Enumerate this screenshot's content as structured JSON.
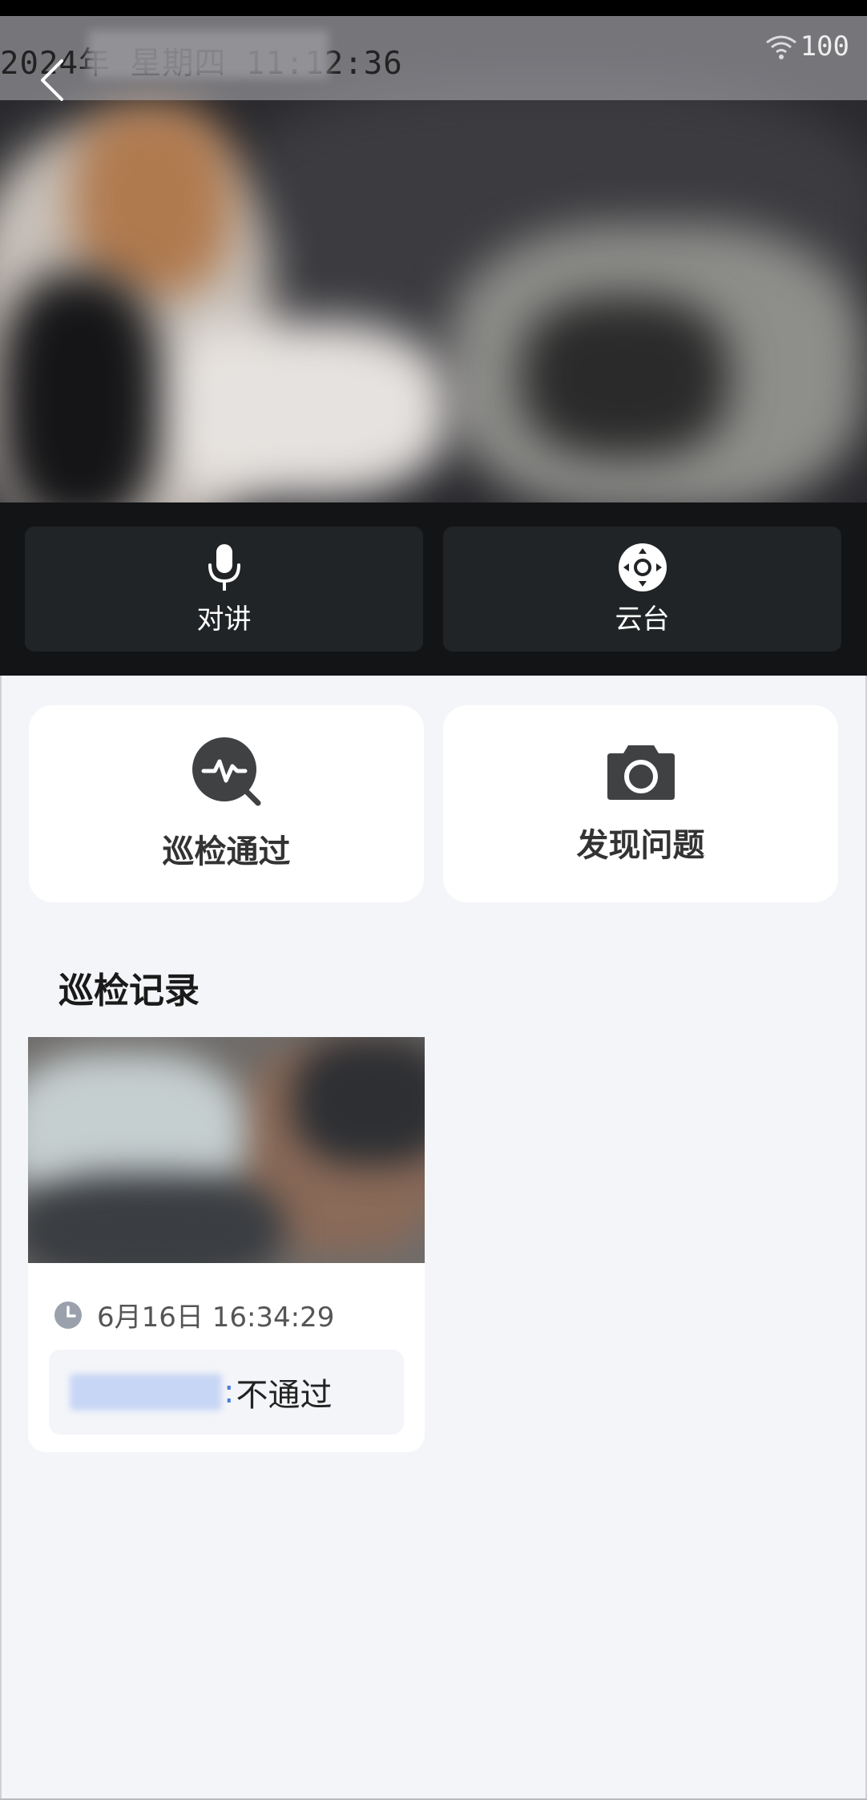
{
  "video": {
    "osd_time": "2024年 星期四 11:12:36",
    "signal": "100",
    "back_icon": "chevron-left-icon"
  },
  "controls": {
    "talk": {
      "label": "对讲",
      "icon": "microphone-icon"
    },
    "ptz": {
      "label": "云台",
      "icon": "ptz-dpad-icon"
    }
  },
  "actions": {
    "pass": {
      "label": "巡检通过",
      "icon": "pulse-search-icon"
    },
    "issue": {
      "label": "发现问题",
      "icon": "camera-icon"
    }
  },
  "records": {
    "title": "巡检记录",
    "items": [
      {
        "time": "6月16日 16:34:29",
        "inspector": "",
        "separator": ":",
        "result": "不通过"
      }
    ]
  },
  "colors": {
    "page_bg": "#f4f5f9",
    "control_bg": "#121416",
    "control_button": "#212426",
    "icon_dark": "#3f4143",
    "card_bg": "#ffffff"
  }
}
